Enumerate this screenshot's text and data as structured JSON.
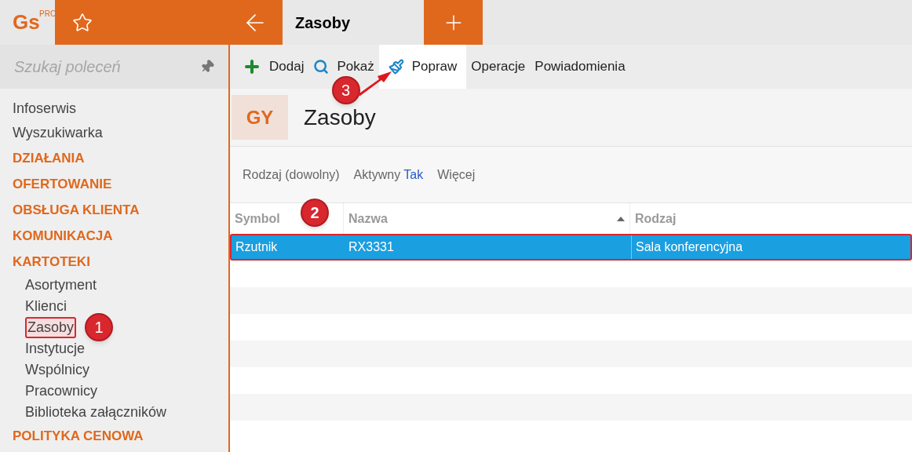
{
  "logo": {
    "text": "Gs",
    "badge": "PRO"
  },
  "tab": {
    "title": "Zasoby"
  },
  "search": {
    "placeholder": "Szukaj poleceń"
  },
  "sidebar": {
    "items": [
      {
        "label": "Infoserwis",
        "kind": "link",
        "selected": false
      },
      {
        "label": "Wyszukiwarka",
        "kind": "link",
        "selected": false
      },
      {
        "label": "DZIAŁANIA",
        "kind": "section",
        "selected": false
      },
      {
        "label": "OFERTOWANIE",
        "kind": "section",
        "selected": false
      },
      {
        "label": "OBSŁUGA KLIENTA",
        "kind": "section",
        "selected": false
      },
      {
        "label": "KOMUNIKACJA",
        "kind": "section",
        "selected": false
      },
      {
        "label": "KARTOTEKI",
        "kind": "section",
        "selected": false
      },
      {
        "label": "Asortyment",
        "kind": "child",
        "selected": false
      },
      {
        "label": "Klienci",
        "kind": "child",
        "selected": false
      },
      {
        "label": "Zasoby",
        "kind": "child",
        "selected": true,
        "callout": "1"
      },
      {
        "label": "Instytucje",
        "kind": "child",
        "selected": false
      },
      {
        "label": "Wspólnicy",
        "kind": "child",
        "selected": false
      },
      {
        "label": "Pracownicy",
        "kind": "child",
        "selected": false
      },
      {
        "label": "Biblioteka załączników",
        "kind": "child",
        "selected": false
      },
      {
        "label": "POLITYKA CENOWA",
        "kind": "section",
        "selected": false
      }
    ]
  },
  "toolbar": [
    {
      "label": "Dodaj",
      "selected": false
    },
    {
      "label": "Pokaż",
      "selected": false
    },
    {
      "label": "Popraw",
      "selected": true,
      "callout": "3"
    },
    {
      "label": "Operacje",
      "selected": false
    },
    {
      "label": "Powiadomienia",
      "selected": false
    }
  ],
  "header": {
    "badge": "GY",
    "title": "Zasoby"
  },
  "filters": [
    {
      "label": "Rodzaj (dowolny)"
    },
    {
      "label": "Aktywny",
      "value": "Tak"
    },
    {
      "label": "Więcej"
    }
  ],
  "table": {
    "callout": "2",
    "columns": [
      {
        "label": "Symbol",
        "sorted": false
      },
      {
        "label": "Nazwa",
        "sorted": true
      },
      {
        "label": "Rodzaj",
        "sorted": false
      }
    ],
    "rows": [
      {
        "cells": [
          "Rzutnik",
          "RX3331",
          "Sala konferencyjna"
        ],
        "selected": true
      }
    ]
  }
}
